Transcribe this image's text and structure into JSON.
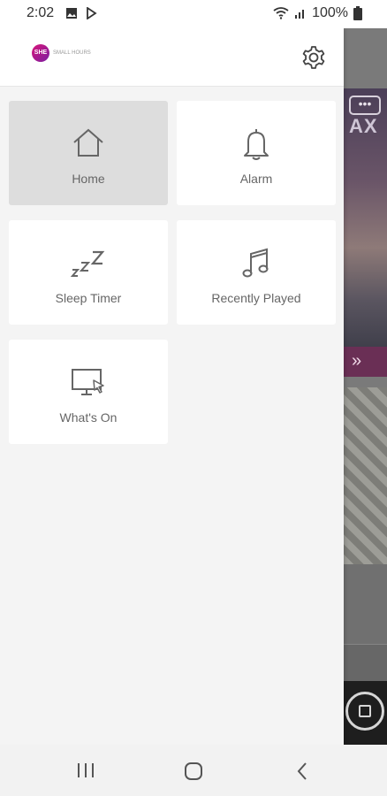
{
  "status_bar": {
    "time": "2:02",
    "battery": "100%",
    "icons": [
      "image-icon",
      "play-icon",
      "wifi-icon",
      "signal-icon",
      "battery-icon"
    ]
  },
  "drawer": {
    "logo_text": "SHE",
    "logo_subtext": "SMALL HOURS",
    "settings_icon": "gear-icon",
    "menu": [
      {
        "label": "Home",
        "icon": "home-icon",
        "active": true
      },
      {
        "label": "Alarm",
        "icon": "bell-icon",
        "active": false
      },
      {
        "label": "Sleep Timer",
        "icon": "sleep-icon",
        "active": false
      },
      {
        "label": "Recently Played",
        "icon": "music-note-icon",
        "active": false
      },
      {
        "label": "What's On",
        "icon": "monitor-cursor-icon",
        "active": false
      }
    ]
  },
  "background_app": {
    "hero_text": "AX",
    "more_label": "•••",
    "chevron_label": "»"
  },
  "nav_bar": {
    "buttons": [
      "recents-icon",
      "home-button-icon",
      "back-icon"
    ]
  },
  "colors": {
    "accent": "#6a2f55",
    "drawer_bg": "#f4f4f4",
    "tile_active": "#dddddd",
    "icon": "#666666"
  }
}
